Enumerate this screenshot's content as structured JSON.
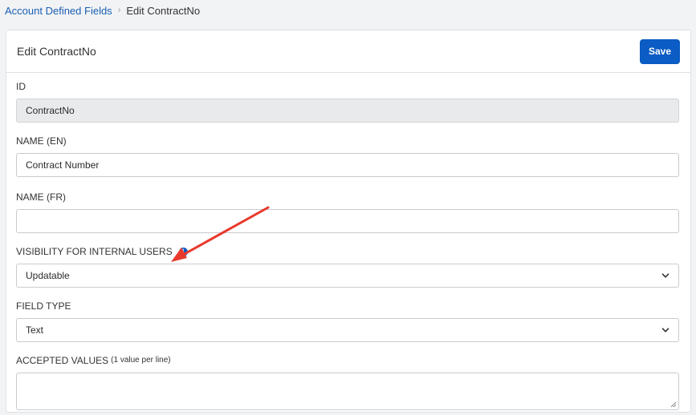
{
  "breadcrumb": {
    "parent": "Account Defined Fields",
    "current": "Edit ContractNo"
  },
  "card": {
    "title": "Edit ContractNo",
    "save_label": "Save"
  },
  "fields": {
    "id": {
      "label": "ID",
      "value": "ContractNo"
    },
    "name_en": {
      "label": "NAME (EN)",
      "value": "Contract Number"
    },
    "name_fr": {
      "label": "NAME (FR)",
      "value": ""
    },
    "visibility": {
      "label": "VISIBILITY FOR INTERNAL USERS",
      "value": "Updatable"
    },
    "field_type": {
      "label": "FIELD TYPE",
      "value": "Text"
    },
    "accepted_values": {
      "label": "ACCEPTED VALUES",
      "hint": "(1 value per line)",
      "value": ""
    }
  },
  "colors": {
    "accent": "#0b5cc4",
    "annotation_arrow": "#e8392b"
  },
  "icons": {
    "breadcrumb_separator": "chevron-right-icon",
    "info": "info-icon",
    "select": "chevron-down-icon"
  }
}
